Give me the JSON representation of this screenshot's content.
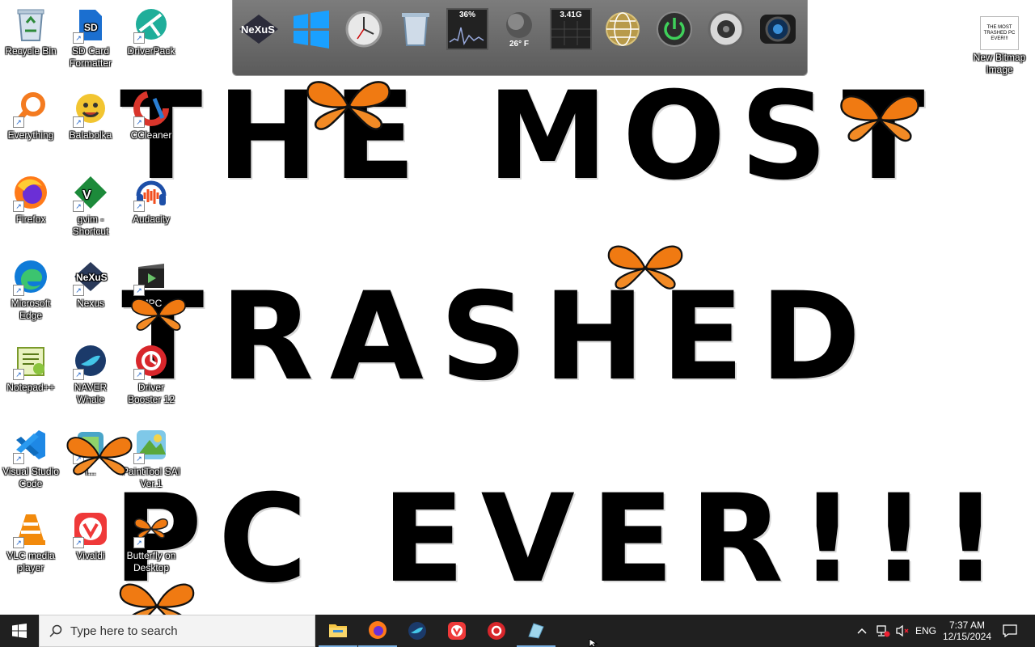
{
  "wallpaper": {
    "line1": "THE MOST",
    "line2": "TRASHED",
    "line3": "PC EVER!!!"
  },
  "desktop_icons": [
    {
      "label": "Recycle Bin",
      "icon": "recycle-bin-icon"
    },
    {
      "label": "SD Card Formatter",
      "icon": "sd-card-icon"
    },
    {
      "label": "DriverPack",
      "icon": "driverpack-icon"
    },
    {
      "label": "Everything",
      "icon": "everything-search-icon"
    },
    {
      "label": "Balabolka",
      "icon": "balabolka-icon"
    },
    {
      "label": "CCleaner",
      "icon": "ccleaner-icon"
    },
    {
      "label": "Firefox",
      "icon": "firefox-icon"
    },
    {
      "label": "gvim - Shortcut",
      "icon": "vim-icon"
    },
    {
      "label": "Audacity",
      "icon": "audacity-icon"
    },
    {
      "label": "Microsoft Edge",
      "icon": "edge-icon"
    },
    {
      "label": "Nexus",
      "icon": "nexus-icon"
    },
    {
      "label": "MPC",
      "icon": "mpc-icon"
    },
    {
      "label": "Notepad++",
      "icon": "notepadpp-icon"
    },
    {
      "label": "NAVER Whale",
      "icon": "whale-icon"
    },
    {
      "label": "Driver Booster 12",
      "icon": "driver-booster-icon"
    },
    {
      "label": "Visual Studio Code",
      "icon": "vscode-icon"
    },
    {
      "label": "I...",
      "icon": "app-icon"
    },
    {
      "label": "PaintTool SAI Ver.1",
      "icon": "painttool-sai-icon"
    },
    {
      "label": "VLC media player",
      "icon": "vlc-icon"
    },
    {
      "label": "Vivaldi",
      "icon": "vivaldi-icon"
    },
    {
      "label": "Butterfly on Desktop",
      "icon": "butterfly-app-icon"
    },
    {
      "label": "New Bitmap Image",
      "icon": "bitmap-file-icon",
      "thumb_text": "THE MOST TRASHED PC EVER!!!"
    }
  ],
  "dock": {
    "items": [
      {
        "name": "nexus-logo",
        "label": "NeXuS"
      },
      {
        "name": "windows-logo",
        "label": ""
      },
      {
        "name": "clock",
        "label": ""
      },
      {
        "name": "recycle-bin",
        "label": ""
      },
      {
        "name": "cpu-meter",
        "label": "36%"
      },
      {
        "name": "weather",
        "label": "26° F"
      },
      {
        "name": "ram-meter",
        "label": "3.41G"
      },
      {
        "name": "internet-globe",
        "label": ""
      },
      {
        "name": "power",
        "label": ""
      },
      {
        "name": "speaker",
        "label": ""
      },
      {
        "name": "camera",
        "label": ""
      }
    ]
  },
  "taskbar": {
    "search_placeholder": "Type here to search",
    "apps": [
      "file-explorer",
      "firefox",
      "naver-whale",
      "vivaldi",
      "driver-booster",
      "painttool-sai"
    ],
    "tray": {
      "language": "ENG",
      "time": "7:37 AM",
      "date": "12/15/2024"
    }
  },
  "colors": {
    "taskbar_bg": "#202020",
    "dock_bg": "#6a6a6a",
    "windows_blue": "#1e90ff",
    "butterfly_orange": "#f07a12"
  }
}
